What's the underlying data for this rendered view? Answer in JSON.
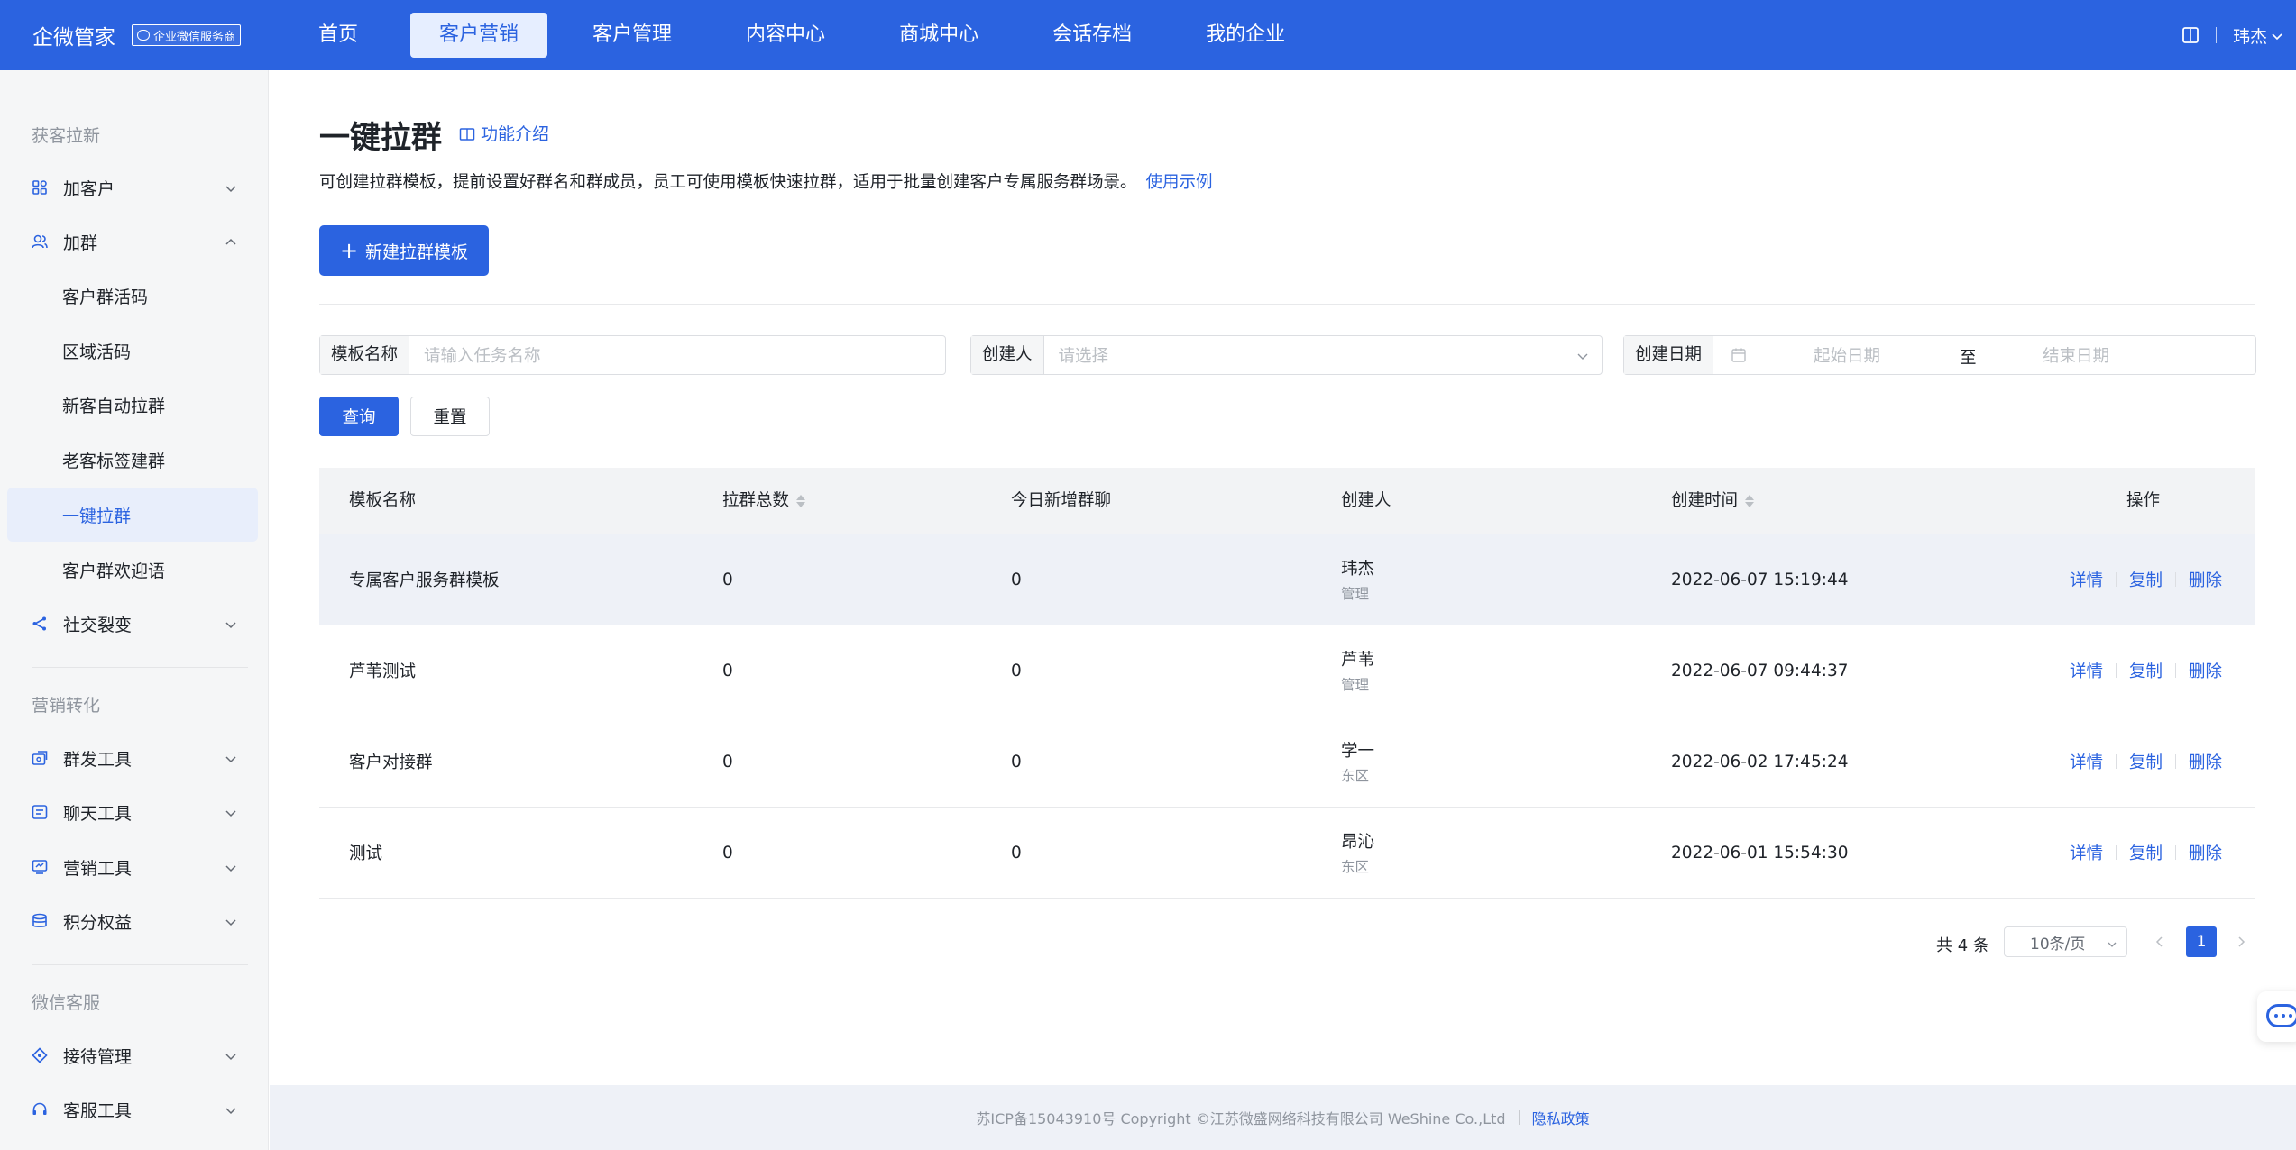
{
  "brand": {
    "name": "企微管家",
    "badge": "企业微信服务商"
  },
  "nav": {
    "items": [
      "首页",
      "客户营销",
      "客户管理",
      "内容中心",
      "商城中心",
      "会话存档",
      "我的企业"
    ],
    "active_index": 1
  },
  "user": {
    "name": "玮杰"
  },
  "sidebar": {
    "groups": [
      "获客拉新",
      "营销转化",
      "微信客服"
    ],
    "items": {
      "add_customer": "加客户",
      "add_group": "加群",
      "social_fission": "社交裂变",
      "mass_tools": "群发工具",
      "chat_tools": "聊天工具",
      "marketing_tools": "营销工具",
      "points": "积分权益",
      "reception": "接待管理",
      "service_tools": "客服工具"
    },
    "sub_items": [
      "客户群活码",
      "区域活码",
      "新客自动拉群",
      "老客标签建群",
      "一键拉群",
      "客户群欢迎语"
    ],
    "active_sub_index": 4
  },
  "page": {
    "title": "一键拉群",
    "intro_link": "功能介绍",
    "description": "可创建拉群模板，提前设置好群名和群成员，员工可使用模板快速拉群，适用于批量创建客户专属服务群场景。",
    "example_link": "使用示例",
    "new_button": "新建拉群模板"
  },
  "filters": {
    "name_label": "模板名称",
    "name_placeholder": "请输入任务名称",
    "creator_label": "创建人",
    "creator_placeholder": "请选择",
    "date_label": "创建日期",
    "date_start": "起始日期",
    "date_sep": "至",
    "date_end": "结束日期",
    "query": "查询",
    "reset": "重置"
  },
  "table": {
    "headers": [
      "模板名称",
      "拉群总数",
      "今日新增群聊",
      "创建人",
      "创建时间",
      "操作"
    ],
    "rows": [
      {
        "name": "专属客户服务群模板",
        "total": "0",
        "today": "0",
        "creator": "玮杰",
        "role": "管理",
        "time": "2022-06-07 15:19:44"
      },
      {
        "name": "芦苇测试",
        "total": "0",
        "today": "0",
        "creator": "芦苇",
        "role": "管理",
        "time": "2022-06-07 09:44:37"
      },
      {
        "name": "客户对接群",
        "total": "0",
        "today": "0",
        "creator": "学一",
        "role": "东区",
        "time": "2022-06-02 17:45:24"
      },
      {
        "name": "测试",
        "total": "0",
        "today": "0",
        "creator": "昂沁",
        "role": "东区",
        "time": "2022-06-01 15:54:30"
      }
    ],
    "actions": [
      "详情",
      "复制",
      "删除"
    ]
  },
  "pagination": {
    "total": "共 4 条",
    "page_size": "10条/页",
    "current": "1"
  },
  "footer": {
    "copyright": "苏ICP备15043910号 Copyright ©江苏微盛网络科技有限公司 WeShine Co.,Ltd",
    "privacy": "隐私政策"
  }
}
